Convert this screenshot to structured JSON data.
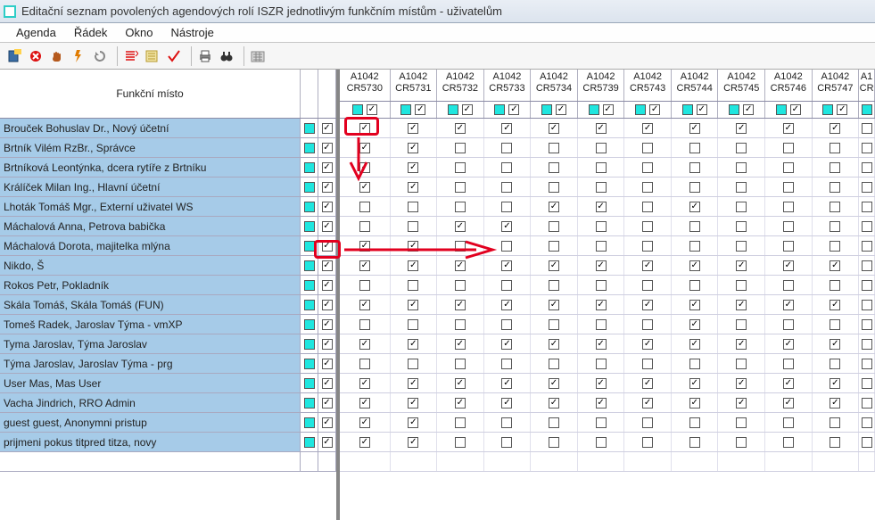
{
  "title": "Editační seznam povolených agendových rolí ISZR jednotlivým funkčním místům - uživatelům",
  "menu": {
    "agenda": "Agenda",
    "radek": "Řádek",
    "okno": "Okno",
    "nastroje": "Nástroje"
  },
  "toolbar_icons": {
    "i0": "",
    "i1": "",
    "i2": "",
    "i3": "",
    "i4": "",
    "i5": "",
    "i6": "",
    "i7": "",
    "i8": "",
    "i9": "",
    "i10": "",
    "i11": "",
    "i12": ""
  },
  "left_header": "Funkční místo",
  "columns": [
    {
      "l1": "A1042",
      "l2": "CR5730"
    },
    {
      "l1": "A1042",
      "l2": "CR5731"
    },
    {
      "l1": "A1042",
      "l2": "CR5732"
    },
    {
      "l1": "A1042",
      "l2": "CR5733"
    },
    {
      "l1": "A1042",
      "l2": "CR5734"
    },
    {
      "l1": "A1042",
      "l2": "CR5739"
    },
    {
      "l1": "A1042",
      "l2": "CR5743"
    },
    {
      "l1": "A1042",
      "l2": "CR5744"
    },
    {
      "l1": "A1042",
      "l2": "CR5745"
    },
    {
      "l1": "A1042",
      "l2": "CR5746"
    },
    {
      "l1": "A1042",
      "l2": "CR5747"
    },
    {
      "l1": "A1",
      "l2": "CR"
    }
  ],
  "filter": {
    "cyan": true,
    "checked": true
  },
  "rows": [
    {
      "name": "Brouček Bohuslav Dr., Nový účetní",
      "cells": [
        1,
        1,
        1,
        1,
        1,
        1,
        1,
        1,
        1,
        1,
        1,
        0
      ]
    },
    {
      "name": "Brtník Vilém  RzBr., Správce",
      "cells": [
        1,
        1,
        0,
        0,
        0,
        0,
        0,
        0,
        0,
        0,
        0,
        0
      ]
    },
    {
      "name": "Brtníková Leontýnka, dcera rytíře z Brtníku",
      "cells": [
        1,
        1,
        0,
        0,
        0,
        0,
        0,
        0,
        0,
        0,
        0,
        0
      ]
    },
    {
      "name": "Králíček Milan  Ing., Hlavní účetní",
      "cells": [
        1,
        1,
        0,
        0,
        0,
        0,
        0,
        0,
        0,
        0,
        0,
        0
      ]
    },
    {
      "name": "Lhoták Tomáš Mgr., Externí uživatel WS",
      "cells": [
        0,
        0,
        0,
        0,
        1,
        1,
        0,
        1,
        0,
        0,
        0,
        0
      ]
    },
    {
      "name": "Máchalová Anna, Petrova babička",
      "cells": [
        0,
        0,
        1,
        1,
        0,
        0,
        0,
        0,
        0,
        0,
        0,
        0
      ]
    },
    {
      "name": "Máchalová Dorota, majitelka mlýna",
      "cells": [
        1,
        1,
        0,
        0,
        0,
        0,
        0,
        0,
        0,
        0,
        0,
        0
      ]
    },
    {
      "name": "Nikdo, Š",
      "cells": [
        1,
        1,
        1,
        1,
        1,
        1,
        1,
        1,
        1,
        1,
        1,
        0
      ]
    },
    {
      "name": "Rokos Petr, Pokladník",
      "cells": [
        0,
        0,
        0,
        0,
        0,
        0,
        0,
        0,
        0,
        0,
        0,
        0
      ]
    },
    {
      "name": "Skála Tomáš, Skála Tomáš (FUN)",
      "cells": [
        1,
        1,
        1,
        1,
        1,
        1,
        1,
        1,
        1,
        1,
        1,
        0
      ]
    },
    {
      "name": "Tomeš Radek, Jaroslav Týma - vmXP",
      "cells": [
        0,
        0,
        0,
        0,
        0,
        0,
        0,
        1,
        0,
        0,
        0,
        0
      ]
    },
    {
      "name": "Tyma Jaroslav, Týma Jaroslav",
      "cells": [
        1,
        1,
        1,
        1,
        1,
        1,
        1,
        1,
        1,
        1,
        1,
        0
      ]
    },
    {
      "name": "Týma Jaroslav, Jaroslav Týma - prg",
      "cells": [
        0,
        0,
        0,
        0,
        0,
        0,
        0,
        0,
        0,
        0,
        0,
        0
      ]
    },
    {
      "name": "User Mas, Mas User",
      "cells": [
        1,
        1,
        1,
        1,
        1,
        1,
        1,
        1,
        1,
        1,
        1,
        0
      ]
    },
    {
      "name": "Vacha Jindrich, RRO Admin",
      "cells": [
        1,
        1,
        1,
        1,
        1,
        1,
        1,
        1,
        1,
        1,
        1,
        0
      ]
    },
    {
      "name": "guest guest, Anonymni pristup",
      "cells": [
        1,
        1,
        0,
        0,
        0,
        0,
        0,
        0,
        0,
        0,
        0,
        0
      ]
    },
    {
      "name": "prijmeni pokus titpred titza, novy",
      "cells": [
        1,
        1,
        0,
        0,
        0,
        0,
        0,
        0,
        0,
        0,
        0,
        0
      ]
    }
  ],
  "annotation_color": "#e2001f"
}
